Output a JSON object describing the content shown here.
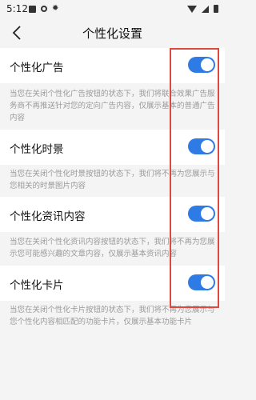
{
  "status_bar": {
    "time": "5:12"
  },
  "header": {
    "title": "个性化设置"
  },
  "settings": [
    {
      "label": "个性化广告",
      "enabled": true,
      "description": "当您在关闭个性化广告按钮的状态下，我们将联合效果广告服务商不再推送针对您的定向广告内容，仅展示基本的普通广告内容"
    },
    {
      "label": "个性化时景",
      "enabled": true,
      "description": "当您在关闭个性化时景按钮的状态下，我们将不再为您展示与您相关的时景图片内容"
    },
    {
      "label": "个性化资讯内容",
      "enabled": true,
      "description": "当您在关闭个性化资讯内容按钮的状态下，我们将不再为您展示您可能感兴趣的文章内容，仅展示基本资讯内容"
    },
    {
      "label": "个性化卡片",
      "enabled": true,
      "description": "当您在关闭个性化卡片按钮的状态下，我们将不再为您展示与您个性化内容相匹配的功能卡片，仅展示基本功能卡片"
    }
  ],
  "colors": {
    "toggle_on": "#2f7be6",
    "highlight": "#e0483e"
  }
}
